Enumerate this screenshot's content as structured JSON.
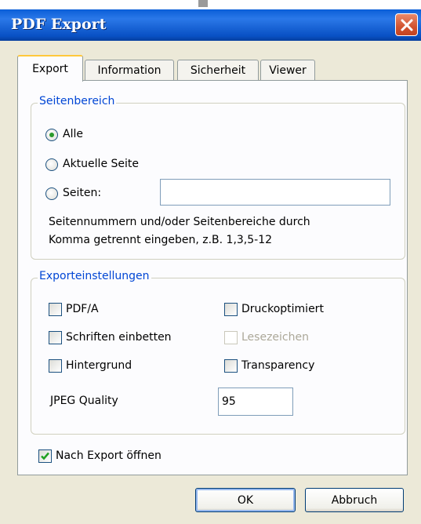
{
  "window": {
    "title": "PDF Export"
  },
  "tabs": [
    "Export",
    "Information",
    "Sicherheit",
    "Viewer"
  ],
  "active_tab": "Export",
  "page_range": {
    "group_title": "Seitenbereich",
    "options": [
      "Alle",
      "Aktuelle Seite",
      "Seiten:"
    ],
    "selected": "Alle",
    "pages_value": "",
    "hint_line1": "Seitennummern und/oder Seitenbereiche durch",
    "hint_line2": "Komma getrennt eingeben, z.B. 1,3,5-12"
  },
  "export_settings": {
    "group_title": "Exporteinstellungen",
    "pdfa": {
      "label": "PDF/A",
      "checked": false
    },
    "embed_fonts": {
      "label": "Schriften einbetten",
      "checked": false
    },
    "background": {
      "label": "Hintergrund",
      "checked": false
    },
    "print_optimized": {
      "label": "Druckoptimiert",
      "checked": false
    },
    "bookmarks": {
      "label": "Lesezeichen",
      "checked": false,
      "disabled": true
    },
    "transparency": {
      "label": "Transparency",
      "checked": false
    },
    "jpeg_quality_label": "JPEG Quality",
    "jpeg_quality_value": "95"
  },
  "open_after_export": {
    "label": "Nach Export öffnen",
    "checked": true
  },
  "buttons": {
    "ok": "OK",
    "cancel": "Abbruch"
  },
  "colors": {
    "title_bar": "#0a5fd8",
    "group_title": "#0046d5",
    "check_green": "#21a121",
    "dialog_bg": "#ece9d8"
  }
}
